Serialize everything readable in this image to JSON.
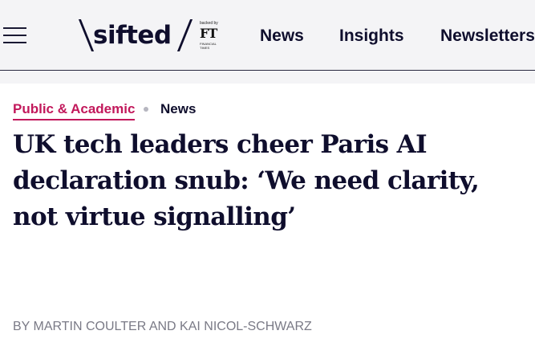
{
  "header": {
    "logo": {
      "wordmark": "sifted",
      "backed_by": "backed by",
      "ft_mark": "FT",
      "ft_name": "FINANCIAL TIMES"
    },
    "nav": {
      "news": "News",
      "insights": "Insights",
      "newsletters": "Newsletters"
    }
  },
  "article": {
    "category": "Public & Academic",
    "section": "News",
    "headline": "UK tech leaders cheer Paris AI declaration snub: ‘We need clarity, not virtue signalling’",
    "byline": "BY MARTIN COULTER AND KAI NICOL-SCHWARZ"
  },
  "colors": {
    "brand_navy": "#0f0e2d",
    "category_accent": "#c2185b",
    "byline_grey": "#7a7a86",
    "header_bg": "#f4f4f6"
  },
  "icons": [
    "hamburger-menu-icon"
  ]
}
